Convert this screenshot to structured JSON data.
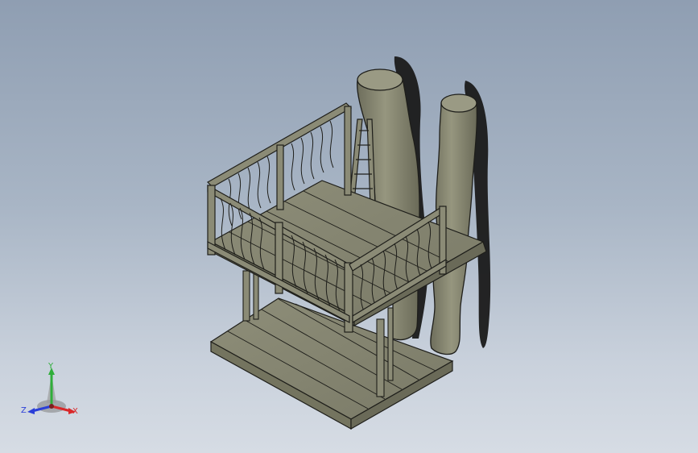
{
  "viewport": {
    "background_top": "#8f9eb2",
    "background_bottom": "#d6dce4"
  },
  "model": {
    "body_color": "#8b8b76",
    "edge_color": "#1e1e1a",
    "trunk_color": "#8a8a74",
    "shadow_color": "#1a1a1a"
  },
  "triad": {
    "x_label": "X",
    "y_label": "Y",
    "z_label": "Z",
    "x_color": "#d9282a",
    "y_color": "#2fae3a",
    "z_color": "#2b3fd8"
  }
}
